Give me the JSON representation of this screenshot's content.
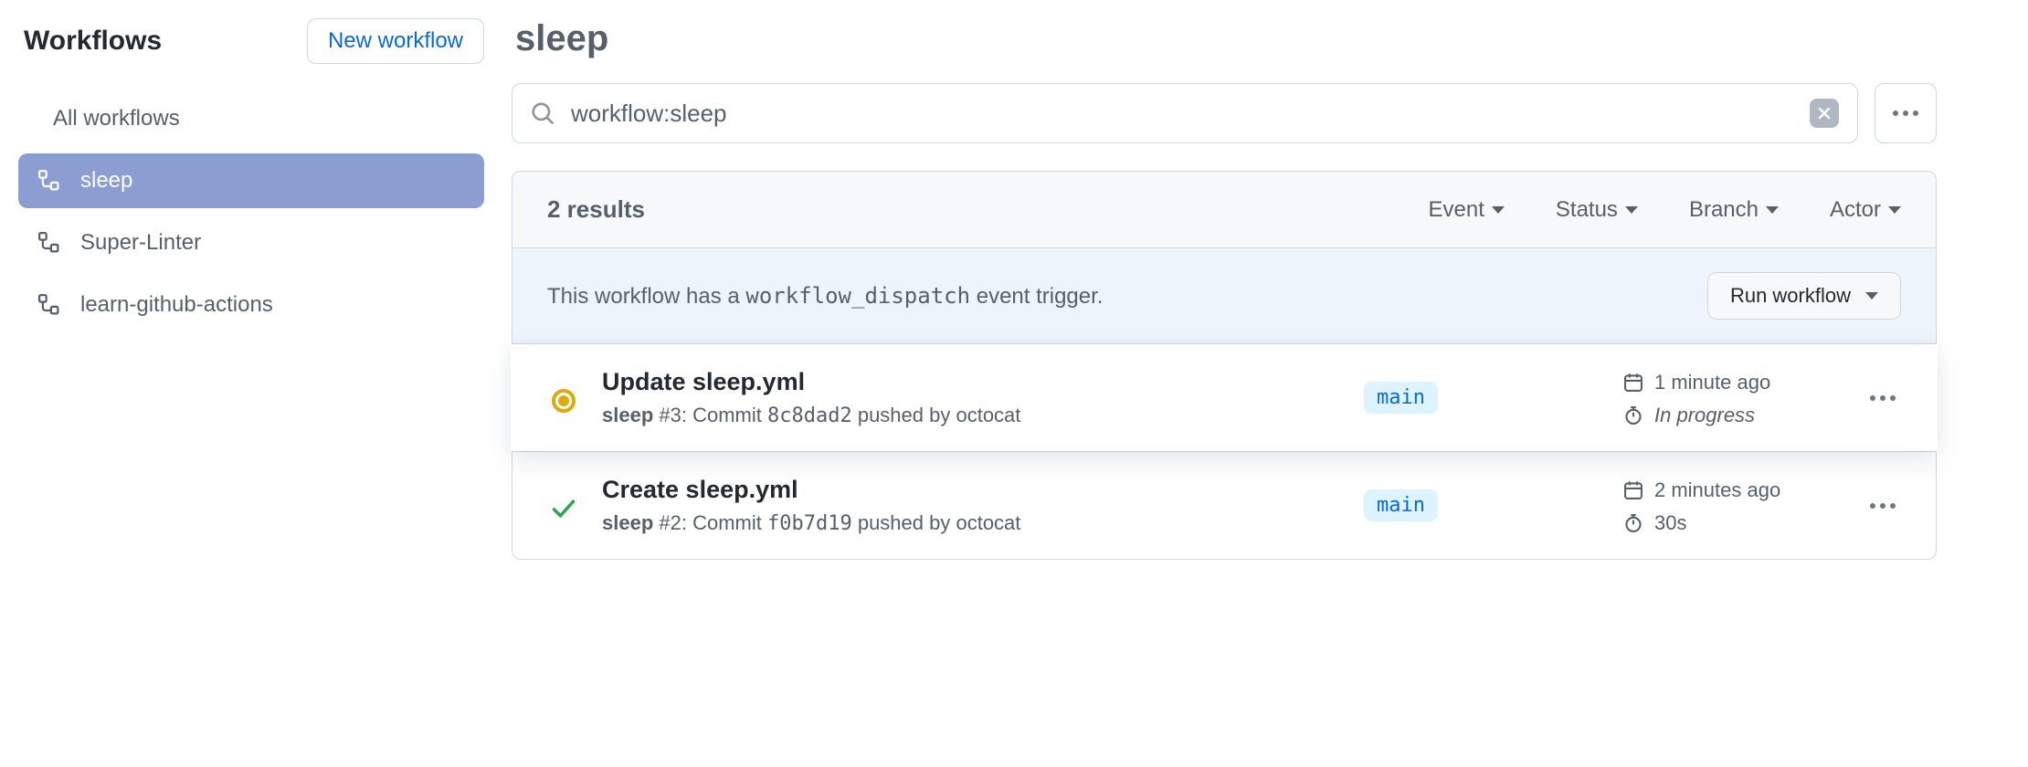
{
  "sidebar": {
    "title": "Workflows",
    "new_button": "New workflow",
    "items": [
      {
        "label": "All workflows"
      },
      {
        "label": "sleep"
      },
      {
        "label": "Super-Linter"
      },
      {
        "label": "learn-github-actions"
      }
    ]
  },
  "page": {
    "title": "sleep"
  },
  "search": {
    "value": "workflow:sleep"
  },
  "results": {
    "count_label": "2 results"
  },
  "filters": {
    "event": "Event",
    "status": "Status",
    "branch": "Branch",
    "actor": "Actor"
  },
  "dispatch": {
    "prefix": "This workflow has a ",
    "code": "workflow_dispatch",
    "suffix": " event trigger.",
    "button": "Run workflow"
  },
  "runs": [
    {
      "title": "Update sleep.yml",
      "workflow": "sleep",
      "run_number": "#3",
      "sub_prefix": ": Commit ",
      "commit": "8c8dad2",
      "sub_mid": " pushed by ",
      "actor": "octocat",
      "branch": "main",
      "time": "1 minute ago",
      "duration": "In progress"
    },
    {
      "title": "Create sleep.yml",
      "workflow": "sleep",
      "run_number": "#2",
      "sub_prefix": ": Commit ",
      "commit": "f0b7d19",
      "sub_mid": " pushed by ",
      "actor": "octocat",
      "branch": "main",
      "time": "2 minutes ago",
      "duration": "30s"
    }
  ]
}
